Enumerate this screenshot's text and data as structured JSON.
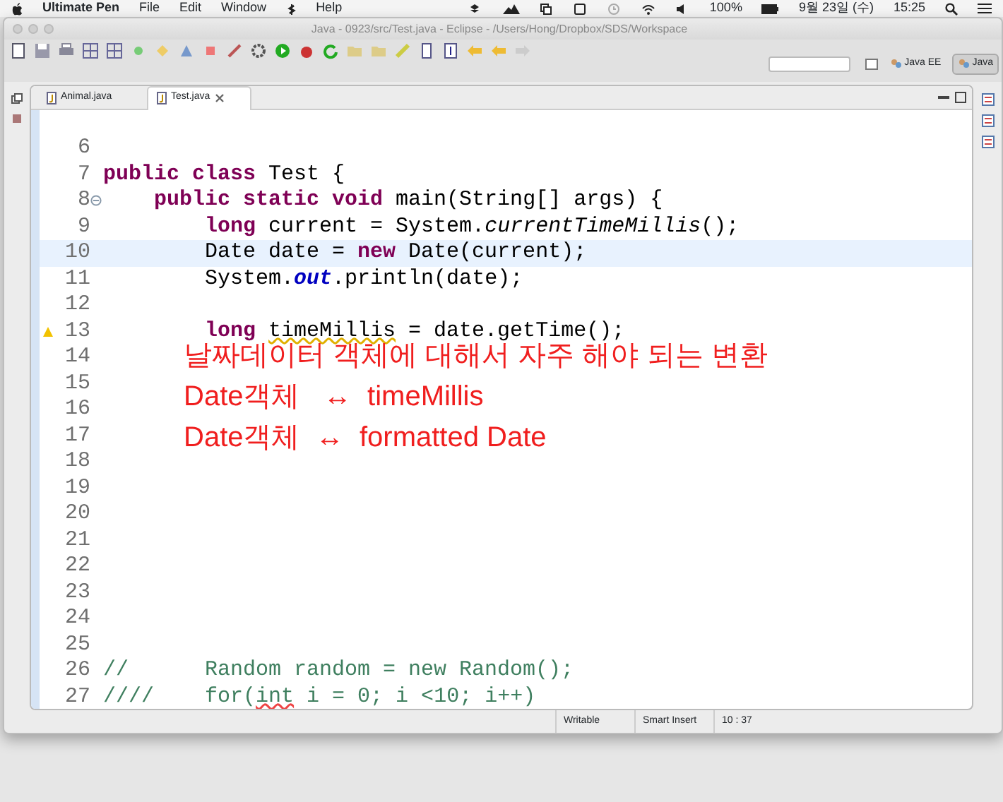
{
  "menu_bar": {
    "app_name": "Ultimate Pen",
    "menus": [
      "File",
      "Edit",
      "Window",
      "Help"
    ],
    "battery": "100%",
    "date": "9월 23일 (수)",
    "time": "15:25"
  },
  "window": {
    "title": "Java - 0923/src/Test.java - Eclipse - /Users/Hong/Dropbox/SDS/Workspace"
  },
  "perspectives": [
    {
      "label": "Java EE",
      "selected": false
    },
    {
      "label": "Java",
      "selected": true
    }
  ],
  "editor_tabs": [
    {
      "label": "Animal.java",
      "selected": false
    },
    {
      "label": "Test.java",
      "selected": true
    }
  ],
  "code_lines": [
    {
      "number": "6",
      "highlighted": false
    },
    {
      "number": "7",
      "highlighted": false,
      "tokens": [
        {
          "kind": "keyword",
          "text": "public class"
        },
        {
          "kind": "plain",
          "text": " Test {"
        }
      ]
    },
    {
      "number": "8",
      "highlighted": false,
      "foldable": true,
      "tokens": [
        {
          "kind": "keyword",
          "text": "    public static void"
        },
        {
          "kind": "plain",
          "text": " main(String[] args) {"
        }
      ]
    },
    {
      "number": "9",
      "highlighted": false,
      "tokens": [
        {
          "kind": "keyword",
          "text": "        long"
        },
        {
          "kind": "plain",
          "text": " current = System."
        },
        {
          "kind": "static_method",
          "text": "currentTimeMillis"
        },
        {
          "kind": "plain",
          "text": "();"
        }
      ]
    },
    {
      "number": "10",
      "highlighted": true,
      "tokens": [
        {
          "kind": "plain",
          "text": "        Date date = "
        },
        {
          "kind": "keyword",
          "text": "new"
        },
        {
          "kind": "plain",
          "text": " Date(current);"
        }
      ]
    },
    {
      "number": "11",
      "highlighted": false,
      "tokens": [
        {
          "kind": "plain",
          "text": "        System."
        },
        {
          "kind": "static_field",
          "text": "out"
        },
        {
          "kind": "plain",
          "text": ".println(date);"
        }
      ]
    },
    {
      "number": "12",
      "highlighted": false
    },
    {
      "number": "13",
      "highlighted": false,
      "warning": true,
      "tokens": [
        {
          "kind": "keyword",
          "text": "        long "
        },
        {
          "kind": "flagged",
          "text": "timeMillis"
        },
        {
          "kind": "plain",
          "text": " = date.getTime();"
        }
      ]
    },
    {
      "number": "14",
      "highlighted": false
    },
    {
      "number": "15",
      "highlighted": false
    },
    {
      "number": "16",
      "highlighted": false
    },
    {
      "number": "17",
      "highlighted": false
    },
    {
      "number": "18",
      "highlighted": false
    },
    {
      "number": "19",
      "highlighted": false
    },
    {
      "number": "20",
      "highlighted": false
    },
    {
      "number": "21",
      "highlighted": false
    },
    {
      "number": "22",
      "highlighted": false
    },
    {
      "number": "23",
      "highlighted": false
    },
    {
      "number": "24",
      "highlighted": false
    },
    {
      "number": "25",
      "highlighted": false
    },
    {
      "number": "26",
      "highlighted": false,
      "tokens": [
        {
          "kind": "comment",
          "text": "//      Random random = new Random();"
        }
      ]
    },
    {
      "number": "27",
      "highlighted": false,
      "tokens": [
        {
          "kind": "comment",
          "text": "////    for("
        },
        {
          "kind": "comment_flagged",
          "text": "int"
        },
        {
          "kind": "comment",
          "text": " i = 0; i <10; i++)"
        }
      ]
    }
  ],
  "annotation": [
    "날짜데이터 객체에 대해서 자주 해야 되는 변환",
    "Date객체   ↔  timeMillis",
    "Date객체  ↔  formatted Date"
  ],
  "status_bar": [
    "Writable",
    "Smart Insert",
    "10 : 37"
  ]
}
